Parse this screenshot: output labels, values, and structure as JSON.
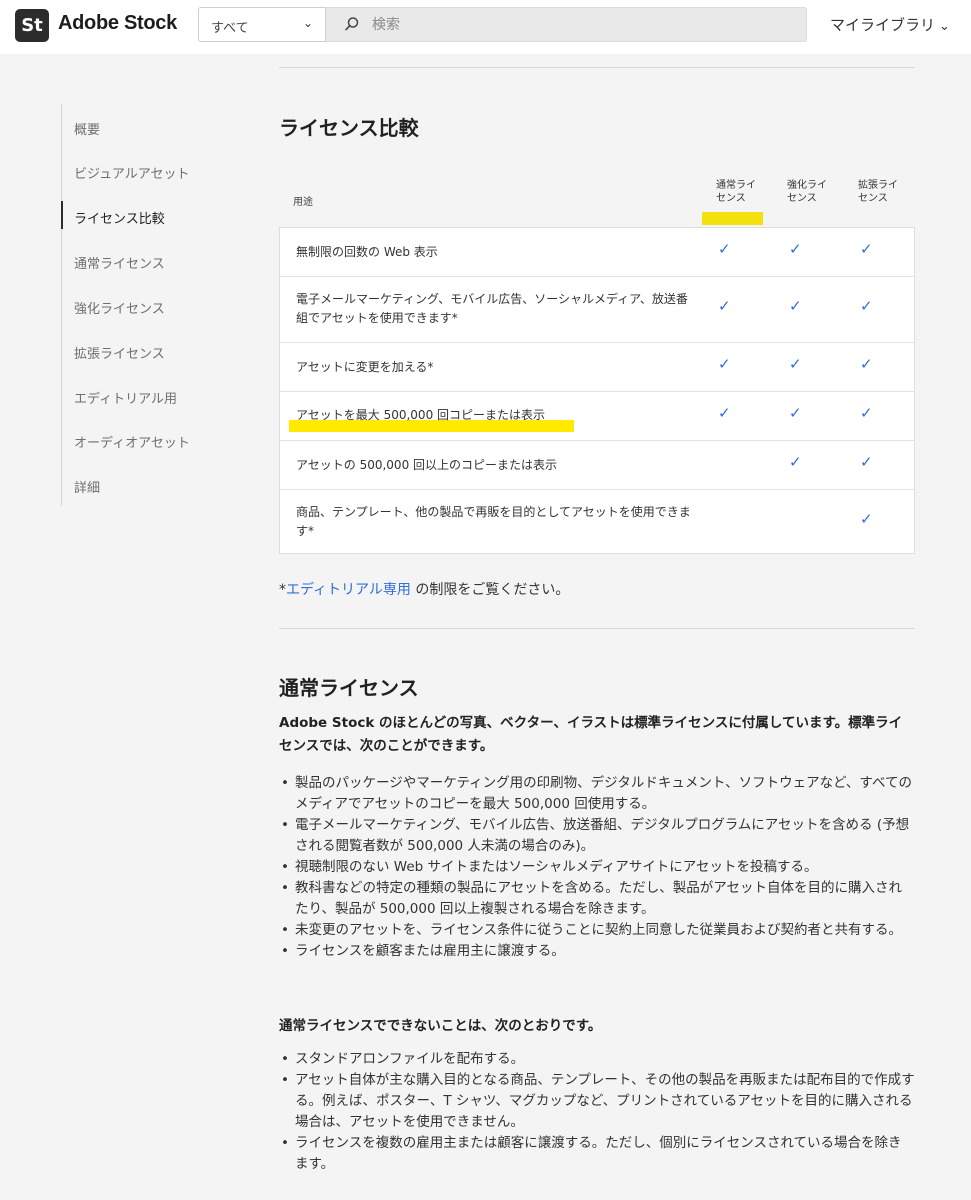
{
  "header": {
    "logo_badge": "St",
    "logo_text": "Adobe Stock",
    "scope_value": "すべて",
    "search_placeholder": "検索",
    "my_library": "マイライブラリ"
  },
  "sidebar": {
    "items": [
      {
        "label": "概要"
      },
      {
        "label": "ビジュアルアセット"
      },
      {
        "label": "ライセンス比較",
        "active": true
      },
      {
        "label": "通常ライセンス"
      },
      {
        "label": "強化ライセンス"
      },
      {
        "label": "拡張ライセンス"
      },
      {
        "label": "エディトリアル用"
      },
      {
        "label": "オーディオアセット"
      },
      {
        "label": "詳細"
      }
    ]
  },
  "comparison": {
    "title": "ライセンス比較",
    "use_header": "用途",
    "columns": [
      "通常ライセンス",
      "強化ライセンス",
      "拡張ライセンス"
    ],
    "rows": [
      {
        "text": "無制限の回数の Web 表示",
        "checks": [
          true,
          true,
          true
        ]
      },
      {
        "text": "電子メールマーケティング、モバイル広告、ソーシャルメディア、放送番組でアセットを使用できます*",
        "checks": [
          true,
          true,
          true
        ]
      },
      {
        "text": "アセットに変更を加える*",
        "checks": [
          true,
          true,
          true
        ]
      },
      {
        "text": "アセットを最大 500,000 回コピーまたは表示",
        "checks": [
          true,
          true,
          true
        ]
      },
      {
        "text": "アセットの 500,000 回以上のコピーまたは表示",
        "checks": [
          false,
          true,
          true
        ]
      },
      {
        "text": "商品、テンプレート、他の製品で再販を目的としてアセットを使用できます*",
        "checks": [
          false,
          false,
          true
        ]
      }
    ],
    "check_glyph": "✓",
    "note_prefix": "*",
    "note_link": "エディトリアル専用",
    "note_suffix": " の制限をご覧ください。"
  },
  "standard": {
    "title": "通常ライセンス",
    "intro": "Adobe Stock のほとんどの写真、ベクター、イラストは標準ライセンスに付属しています。標準ライセンスでは、次のことができます。",
    "can": [
      "製品のパッケージやマーケティング用の印刷物、デジタルドキュメント、ソフトウェアなど、すべてのメディアでアセットのコピーを最大 500,000 回使用する。",
      "電子メールマーケティング、モバイル広告、放送番組、デジタルプログラムにアセットを含める (予想される閲覧者数が 500,000 人未満の場合のみ)。",
      "視聴制限のない Web サイトまたはソーシャルメディアサイトにアセットを投稿する。",
      "教科書などの特定の種類の製品にアセットを含める。ただし、製品がアセット自体を目的に購入されたり、製品が 500,000 回以上複製される場合を除きます。",
      "未変更のアセットを、ライセンス条件に従うことに契約上同意した従業員および契約者と共有する。",
      "ライセンスを顧客または雇用主に譲渡する。"
    ],
    "cannot_title": "通常ライセンスでできないことは、次のとおりです。",
    "cannot": [
      "スタンドアロンファイルを配布する。",
      "アセット自体が主な購入目的となる商品、テンプレート、その他の製品を再販または配布目的で作成する。例えば、ポスター、T シャツ、マグカップなど、プリントされているアセットを目的に購入される場合は、アセットを使用できません。",
      "ライセンスを複数の雇用主または顧客に譲渡する。ただし、個別にライセンスされている場合を除きます。"
    ]
  },
  "colors": {
    "accent": "#2e6fd8",
    "highlight": "#ffea00",
    "logo_bg": "#2c2c2c"
  }
}
